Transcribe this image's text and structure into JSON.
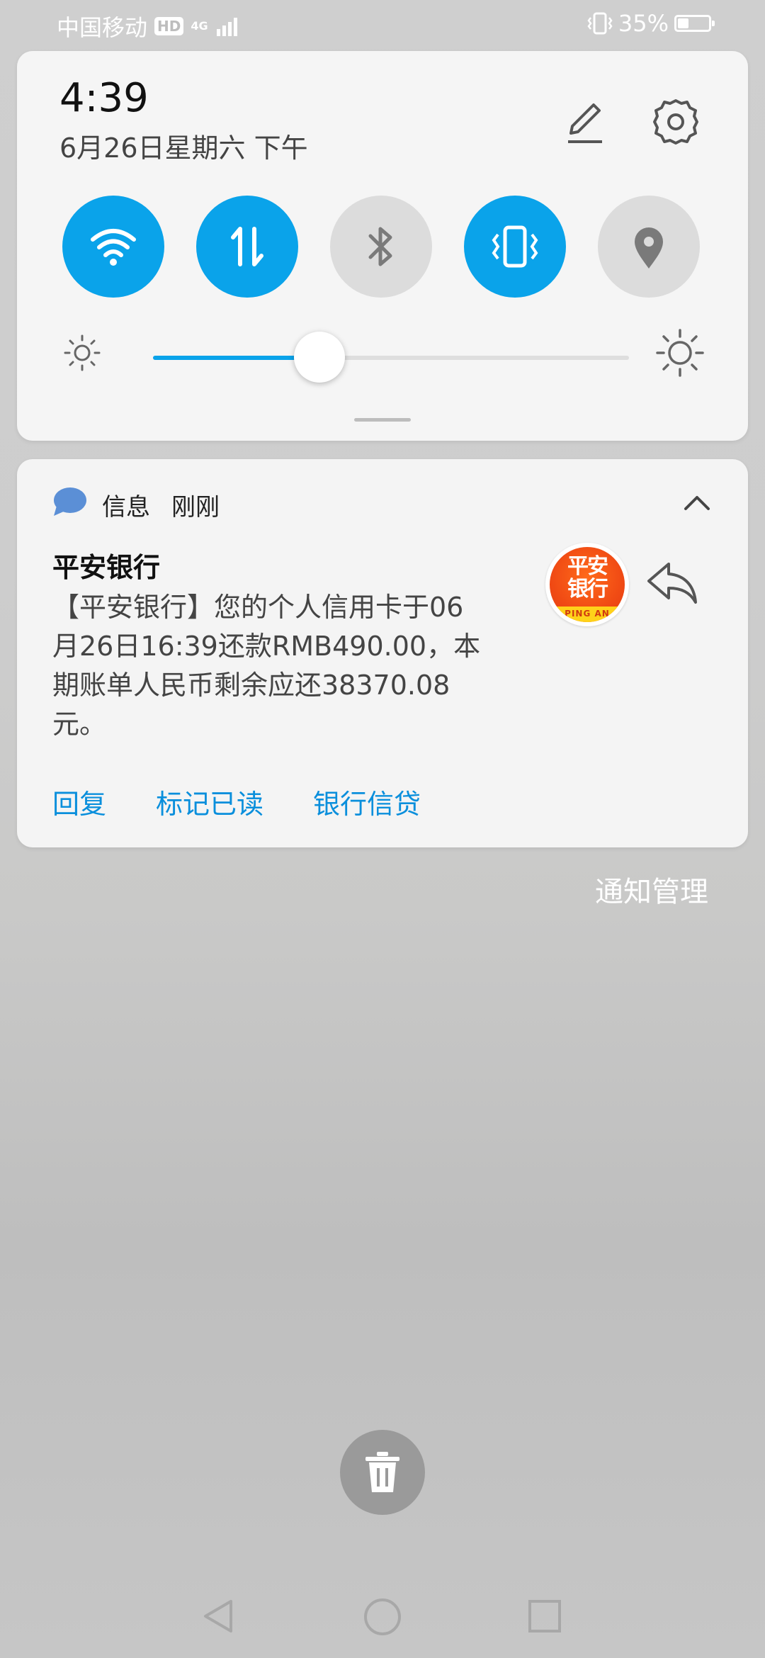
{
  "status_bar": {
    "carrier": "中国移动",
    "hd_badge": "HD",
    "network": "4G",
    "battery_percent": "35%",
    "battery_level": 0.35
  },
  "quick_settings": {
    "time": "4:39",
    "date": "6月26日星期六 下午",
    "toggles": [
      {
        "name": "wifi",
        "state": "on"
      },
      {
        "name": "mobile-data",
        "state": "on"
      },
      {
        "name": "bluetooth",
        "state": "off"
      },
      {
        "name": "vibrate",
        "state": "on"
      },
      {
        "name": "location",
        "state": "off"
      }
    ],
    "brightness_level": 0.35
  },
  "notification": {
    "app_name": "信息",
    "time": "刚刚",
    "title": "平安银行",
    "body": "【平安银行】您的个人信用卡于06\n月26日16:39还款RMB490.00，本\n期账单人民币剩余应还38370.08\n元。",
    "logo_text_line1": "平安",
    "logo_text_line2": "银行",
    "logo_band": "PING AN",
    "actions": [
      "回复",
      "标记已读",
      "银行信贷"
    ]
  },
  "notification_manage": "通知管理",
  "colors": {
    "accent": "#0aa3ea",
    "toggle_off": "#dcdcdc",
    "action_text": "#0a8fdc"
  }
}
